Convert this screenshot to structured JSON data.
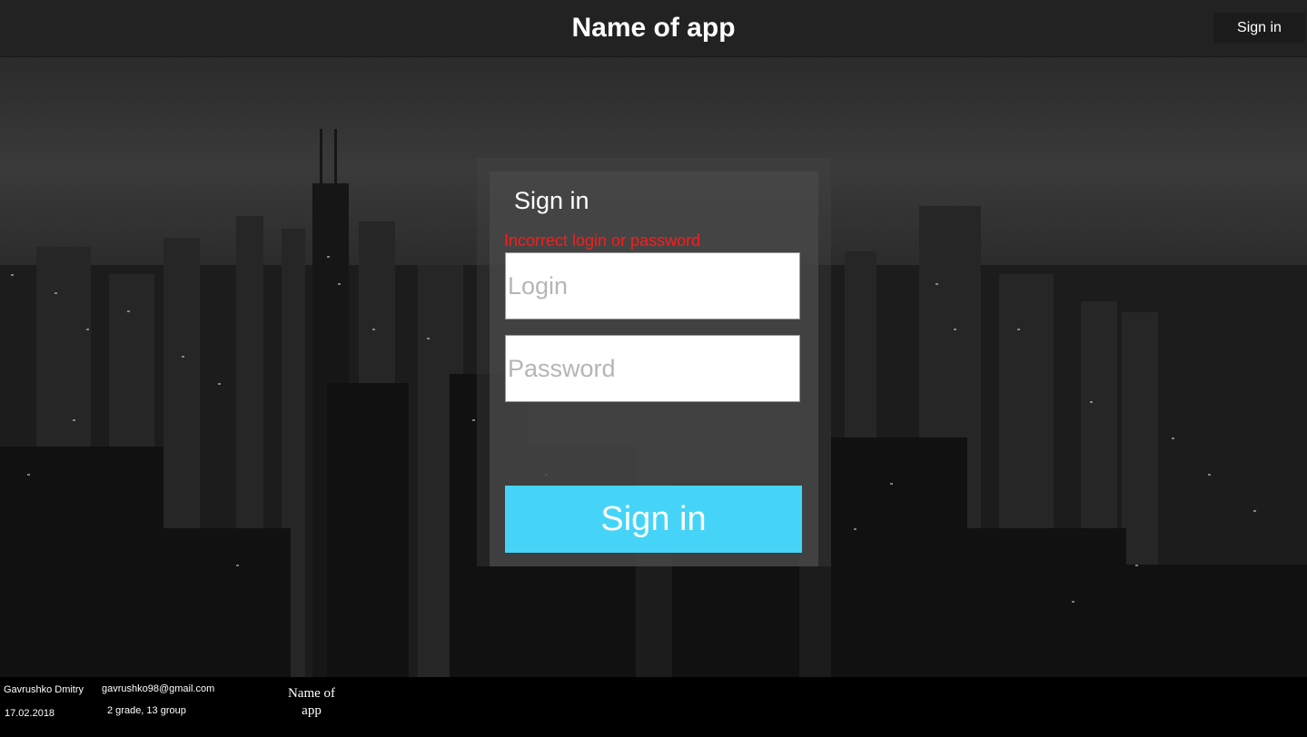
{
  "header": {
    "title": "Name of app",
    "sign_in_label": "Sign in"
  },
  "form": {
    "title": "Sign in",
    "error": "Incorrect login or password",
    "login_placeholder": "Login",
    "login_value": "",
    "password_placeholder": "Password",
    "password_value": "",
    "submit_label": "Sign in"
  },
  "footer": {
    "author": "Gavrushko Dmitry",
    "date": "17.02.2018",
    "email": "gavrushko98@gmail.com",
    "group": "2 grade, 13 group",
    "app_name": "Name of app"
  },
  "colors": {
    "header_bg": "#222222",
    "accent": "#45d4f7",
    "error": "#ff1a1a",
    "footer_bg": "#000000"
  }
}
